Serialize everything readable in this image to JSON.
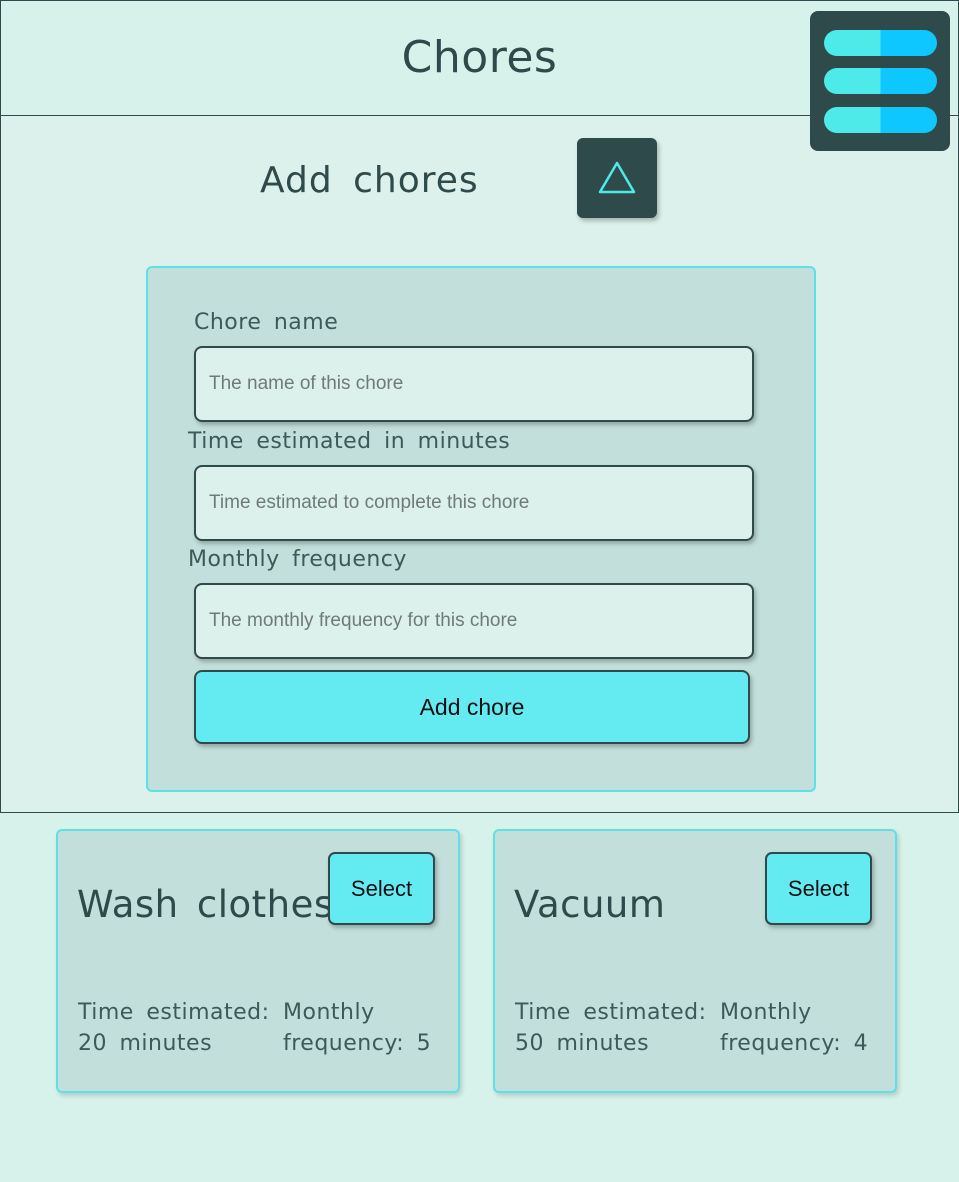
{
  "header": {
    "title": "Chores"
  },
  "menu": {
    "icon": "hamburger-menu-icon"
  },
  "add_section": {
    "title": "Add chores",
    "toggle_icon": "triangle-up-icon",
    "accent": "#4eeaea",
    "form": {
      "name_label": "Chore name",
      "name_placeholder": "The name of this chore",
      "time_label": "Time estimated in minutes",
      "time_placeholder": "Time estimated to complete this chore",
      "freq_label": "Monthly frequency",
      "freq_placeholder": "The monthly frequency for this chore",
      "submit_label": "Add chore"
    }
  },
  "chores": [
    {
      "name": "Wash clothes",
      "select_label": "Select",
      "time_line1": "Time estimated:",
      "time_line2": "20 minutes",
      "freq_line1": "Monthly",
      "freq_line2": "frequency: 5"
    },
    {
      "name": "Vacuum",
      "select_label": "Select",
      "time_line1": "Time estimated:",
      "time_line2": "50 minutes",
      "freq_line1": "Monthly",
      "freq_line2": "frequency: 4"
    }
  ],
  "colors": {
    "background": "#d7f2ea",
    "dark": "#2f4a4a",
    "button": "#64ebf2",
    "card": "#c3dfdb",
    "card_border": "#5fe0e8"
  }
}
